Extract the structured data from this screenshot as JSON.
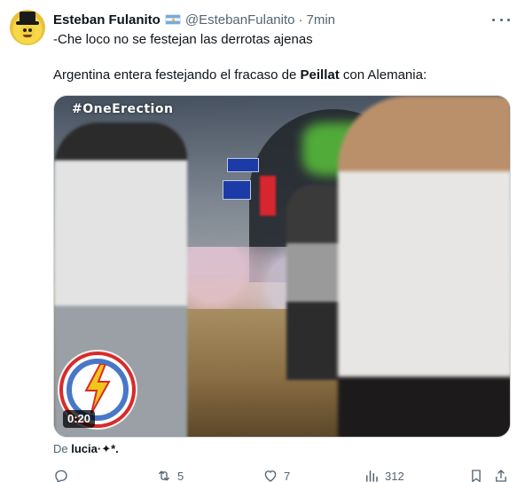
{
  "tweet": {
    "author": {
      "display_name": "Esteban Fulanito",
      "handle": "@EstebanFulanito",
      "separator": "·",
      "time": "7min",
      "flag_icon": "argentina-flag-icon"
    },
    "text_line1": "-Che loco no se festejan las derrotas ajenas",
    "text_line2_before": "Argentina entera festejando el fracaso de ",
    "text_line2_bold": "Peillat",
    "text_line2_after": " con Alemania:",
    "media": {
      "hashtag": "#OneErection",
      "duration": "0:20",
      "logo_icon": "peligro-lightning-logo"
    },
    "attribution": {
      "prefix": "De ",
      "author": "lucia·✦*."
    },
    "actions": {
      "reply": {
        "icon": "reply-icon",
        "count": ""
      },
      "retweet": {
        "icon": "retweet-icon",
        "count": "5"
      },
      "like": {
        "icon": "heart-icon",
        "count": "7"
      },
      "views": {
        "icon": "views-chart-icon",
        "count": "312"
      },
      "bookmark": {
        "icon": "bookmark-icon"
      },
      "share": {
        "icon": "share-icon"
      }
    },
    "colors": {
      "text_primary": "#0f1419",
      "text_secondary": "#536471",
      "border": "#cfd9de"
    }
  }
}
